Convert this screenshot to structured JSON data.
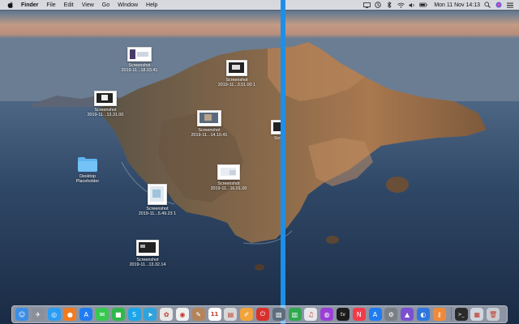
{
  "menubar": {
    "apple_icon": "apple-icon",
    "items": [
      "Finder",
      "File",
      "Edit",
      "View",
      "Go",
      "Window",
      "Help"
    ],
    "clock": "Mon 11 Nov  14:13",
    "status_icons": [
      "display-icon",
      "time-machine-icon",
      "bluetooth-icon",
      "wifi-icon",
      "volume-icon",
      "battery-icon",
      "search-icon",
      "siri-icon",
      "list-icon"
    ]
  },
  "desktop": {
    "icons": [
      {
        "name": "Screenshot",
        "sub": "2019-11...18.03.41"
      },
      {
        "name": "Screenshot",
        "sub": "2019-11...13.31.00"
      },
      {
        "name": "Screenshot",
        "sub": "2019-11...3.51.00 1"
      },
      {
        "name": "Screenshot",
        "sub": "2019-11...14.10.41"
      },
      {
        "name": "Desktop",
        "sub": "Placeholder"
      },
      {
        "name": "Screenshot",
        "sub": "2019-11...16.01.00"
      },
      {
        "name": "Scr",
        "sub": ""
      },
      {
        "name": "Screenshot",
        "sub": "2019-11...5.49.23 1"
      },
      {
        "name": "Screenshot",
        "sub": "2019-11...13.32.14"
      }
    ]
  },
  "dock": {
    "apps": [
      {
        "icon": "finder-icon",
        "color": "#3a8ee6"
      },
      {
        "icon": "launchpad-icon",
        "color": "#8a8f99"
      },
      {
        "icon": "safari-icon",
        "color": "#2a9df4"
      },
      {
        "icon": "firefox-icon",
        "color": "#f27b1f"
      },
      {
        "icon": "app-store-icon",
        "color": "#1f7cf2"
      },
      {
        "icon": "messages-icon",
        "color": "#37c84f"
      },
      {
        "icon": "facetime-icon",
        "color": "#2fb84a"
      },
      {
        "icon": "skype-icon",
        "color": "#1aa6e8"
      },
      {
        "icon": "telegram-icon",
        "color": "#2ea3dc"
      },
      {
        "icon": "photos-icon",
        "color": "#e8e8e8"
      },
      {
        "icon": "chrome-icon",
        "color": "#f0f0f0"
      },
      {
        "icon": "notes-icon",
        "color": "#b5835a"
      },
      {
        "icon": "calendar-icon",
        "color": "#ffffff"
      },
      {
        "icon": "files-icon",
        "color": "#d8d8d8"
      },
      {
        "icon": "pages-icon",
        "color": "#f2a33a"
      },
      {
        "icon": "power-icon",
        "color": "#d9302c"
      },
      {
        "icon": "preview-icon",
        "color": "#5d6d7e"
      },
      {
        "icon": "numbers-icon",
        "color": "#2fa84f"
      },
      {
        "icon": "itunes-icon",
        "color": "#e8e8ec"
      },
      {
        "icon": "podcasts-icon",
        "color": "#9a3fd6"
      },
      {
        "icon": "apple-tv-icon",
        "color": "#1c1c1c"
      },
      {
        "icon": "news-icon",
        "color": "#f23b4a"
      },
      {
        "icon": "app-store-2-icon",
        "color": "#1f7cf2"
      },
      {
        "icon": "system-preferences-icon",
        "color": "#7a7f86"
      },
      {
        "icon": "affinity-icon",
        "color": "#7a4fd0"
      },
      {
        "icon": "screen-recorder-icon",
        "color": "#2f77e0"
      },
      {
        "icon": "keychain-icon",
        "color": "#f08a3a"
      },
      {
        "icon": "terminal-icon",
        "color": "#2a2a2a"
      },
      {
        "icon": "documents-folder-icon",
        "color": "#d0d6de"
      },
      {
        "icon": "trash-icon",
        "color": "#c8ccd2"
      }
    ]
  },
  "divider_color": "#1d8fe8"
}
